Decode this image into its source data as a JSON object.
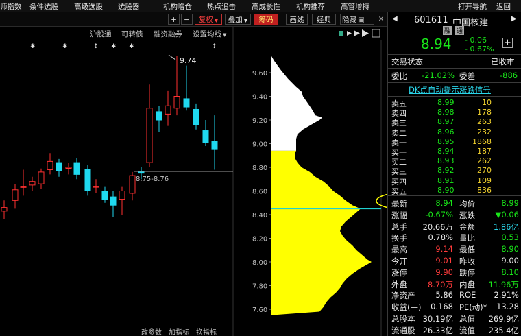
{
  "menu": [
    "师指数",
    "条件选股",
    "高级选股",
    "选股器",
    "机构增仓",
    "热点追击",
    "高成长性",
    "机构推荐",
    "高管增持",
    "打开导航",
    "返回"
  ],
  "toolbar": {
    "plus": "+",
    "minus": "−",
    "fuquan": "复权",
    "overlay": "叠加",
    "chips": "筹码",
    "draw_line": "画线",
    "classic": "经典",
    "hide": "隐藏"
  },
  "subbar": [
    "沪股通",
    "可转债",
    "融资融券",
    "设置均线"
  ],
  "chart": {
    "price_labels": [
      "9.60",
      "9.40",
      "9.20",
      "9.00",
      "8.80",
      "8.60",
      "8.40",
      "8.20",
      "8.00",
      "7.80",
      "7.60"
    ],
    "high_annotation": "9.74",
    "range_annotation": "8.75-8.76",
    "bottom_tabs": [
      "改参数",
      "加指标",
      "换指标"
    ],
    "colors": {
      "up": "#ff3030",
      "down": "#1fd9f0",
      "chip_profit": "#ffff00",
      "chip_loss": "#ffffff",
      "cost_line": "#20d0d0"
    }
  },
  "quote": {
    "code": "601611",
    "name": "中国核建",
    "badges": [
      "融",
      "通"
    ],
    "price": "8.94",
    "change": "- 0.06",
    "change_pct": "- 0.67%",
    "status_label": "交易状态",
    "status_value": "已收市",
    "weibi_label": "委比",
    "weibi_value": "-21.02%",
    "weicha_label": "委差",
    "weicha_value": "-886",
    "signal_title": "DK点自动提示涨跌信号",
    "sells": [
      {
        "label": "卖五",
        "price": "8.99",
        "vol": "10"
      },
      {
        "label": "卖四",
        "price": "8.98",
        "vol": "178"
      },
      {
        "label": "卖三",
        "price": "8.97",
        "vol": "263"
      },
      {
        "label": "卖二",
        "price": "8.96",
        "vol": "232"
      },
      {
        "label": "卖一",
        "price": "8.95",
        "vol": "1868"
      }
    ],
    "buys": [
      {
        "label": "买一",
        "price": "8.94",
        "vol": "187"
      },
      {
        "label": "买二",
        "price": "8.93",
        "vol": "262"
      },
      {
        "label": "买三",
        "price": "8.92",
        "vol": "270"
      },
      {
        "label": "买四",
        "price": "8.91",
        "vol": "109"
      },
      {
        "label": "买五",
        "price": "8.90",
        "vol": "836"
      }
    ],
    "stats": [
      {
        "l1": "最新",
        "v1": "8.94",
        "c1": "grn",
        "l2": "均价",
        "v2": "8.99",
        "c2": "grn"
      },
      {
        "l1": "涨幅",
        "v1": "-0.67%",
        "c1": "grn",
        "l2": "涨跌",
        "v2": "▼0.06",
        "c2": "grn"
      },
      {
        "l1": "总手",
        "v1": "20.66万",
        "c1": "wht",
        "l2": "金额",
        "v2": "1.86亿",
        "c2": "cyan"
      },
      {
        "l1": "换手",
        "v1": "0.78%",
        "c1": "wht",
        "l2": "量比",
        "v2": "0.53",
        "c2": "grn"
      },
      {
        "l1": "最高",
        "v1": "9.14",
        "c1": "red",
        "l2": "最低",
        "v2": "8.90",
        "c2": "grn"
      },
      {
        "l1": "今开",
        "v1": "9.01",
        "c1": "red",
        "l2": "昨收",
        "v2": "9.00",
        "c2": "wht"
      },
      {
        "l1": "涨停",
        "v1": "9.90",
        "c1": "red",
        "l2": "跌停",
        "v2": "8.10",
        "c2": "grn"
      },
      {
        "l1": "外盘",
        "v1": "8.70万",
        "c1": "red",
        "l2": "内盘",
        "v2": "11.96万",
        "c2": "grn"
      },
      {
        "l1": "净资产",
        "v1": "5.86",
        "c1": "wht",
        "l2": "ROE",
        "v2": "2.91%",
        "c2": "wht"
      },
      {
        "l1": "收益(—)",
        "v1": "0.168",
        "c1": "wht",
        "l2": "PE(动)*",
        "v2": "13.28",
        "c2": "wht"
      },
      {
        "l1": "总股本",
        "v1": "30.19亿",
        "c1": "wht",
        "l2": "总值",
        "v2": "269.9亿",
        "c2": "wht"
      },
      {
        "l1": "流通股",
        "v1": "26.33亿",
        "c1": "wht",
        "l2": "流值",
        "v2": "235.4亿",
        "c2": "wht"
      }
    ]
  }
}
